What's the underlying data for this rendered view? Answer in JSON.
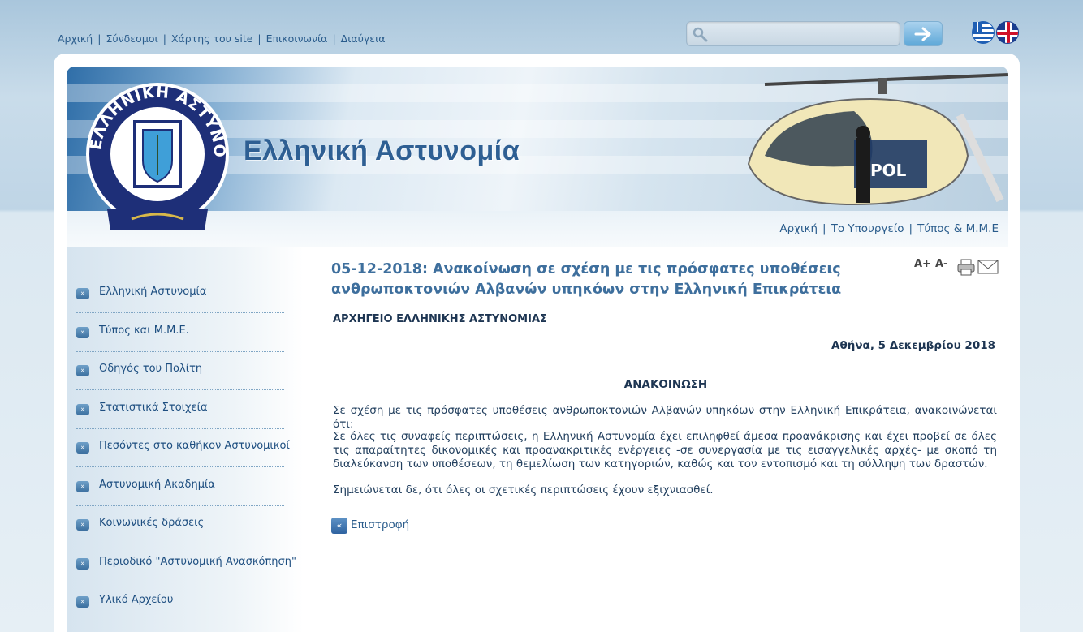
{
  "top_nav": {
    "links": [
      "Αρχική",
      "Σύνδεσμοι",
      "Χάρτης του site",
      "Επικοινωνία",
      "Διαύγεια"
    ]
  },
  "search": {
    "placeholder": ""
  },
  "banner": {
    "title": "Ελληνική Αστυνομία",
    "logo_text": "ΕΛΛΗΝΙΚΗ ΑΣΤΥΝΟΜΙΑ"
  },
  "sub_nav": {
    "links": [
      "Αρχική",
      "Το Υπουργείο",
      "Τύπος & Μ.Μ.Ε"
    ]
  },
  "sidebar": {
    "items": [
      "Ελληνική Αστυνομία",
      "Τύπος και Μ.Μ.Ε.",
      "Οδηγός του Πολίτη",
      "Στατιστικά Στοιχεία",
      "Πεσόντες στο καθήκον Αστυνομικοί",
      "Αστυνομική Ακαδημία",
      "Κοινωνικές δράσεις",
      "Περιοδικό \"Αστυνομική Ανασκόπηση\"",
      "Υλικό Αρχείου"
    ]
  },
  "article": {
    "title": "05-12-2018: Ανακοίνωση σε σχέση με τις πρόσφατες υποθέσεις ανθρωποκτονιών Αλβανών υπηκόων στην Ελληνική Επικράτεια",
    "org": "ΑΡΧΗΓΕΙΟ ΕΛΛΗΝΙΚΗΣ ΑΣΤΥΝΟΜΙΑΣ",
    "date": "Αθήνα, 5 Δεκεμβρίου 2018",
    "heading": "ΑΝΑΚΟΙΝΩΣΗ",
    "p1": "Σε σχέση με τις πρόσφατες υποθέσεις ανθρωποκτονιών Αλβανών υπηκόων στην Ελληνική Επικράτεια, ανακοινώνεται ότι:",
    "p2": "Σε όλες τις συναφείς περιπτώσεις, η Ελληνική Αστυνομία έχει επιληφθεί άμεσα προανάκρισης και έχει προβεί σε όλες τις απαραίτητες δικονομικές και προανακριτικές ενέργειες -σε συνεργασία με τις εισαγγελικές αρχές- με σκοπό τη διαλεύκανση των υποθέσεων, τη θεμελίωση των κατηγοριών, καθώς και τον εντοπισμό και τη σύλληψη των δραστών.",
    "p3": "Σημειώνεται δε, ότι όλες οι σχετικές περιπτώσεις έχουν εξιχνιασθεί.",
    "back": "Επιστροφή"
  },
  "tools": {
    "increase": "A+",
    "decrease": "A-"
  },
  "icons": {
    "search": "magnifier-icon",
    "go": "arrow-right-icon",
    "greek": "greek-flag-icon",
    "english": "uk-flag-icon",
    "print": "printer-icon",
    "email": "envelope-icon",
    "bullet": "double-chevron-right-icon",
    "back": "double-chevron-left-icon"
  },
  "colors": {
    "link": "#2a5c8c",
    "title": "#3e6f9d",
    "accent": "#2e5f93"
  }
}
